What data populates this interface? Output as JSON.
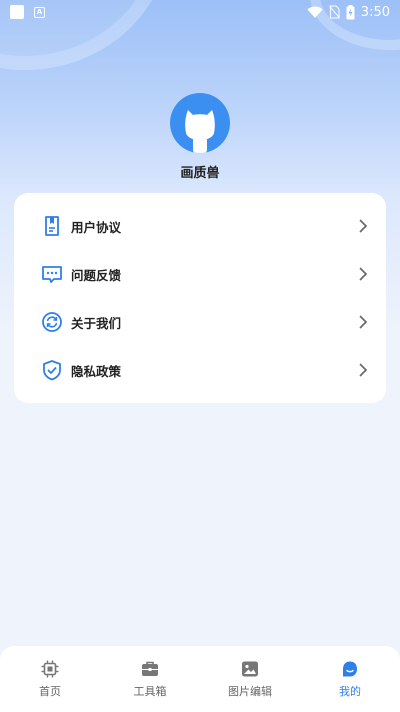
{
  "status_bar": {
    "time": "3:50",
    "icons": [
      "app-square-icon",
      "a-notification-icon",
      "wifi-icon",
      "no-sim-icon",
      "battery-charging-icon"
    ]
  },
  "profile": {
    "avatar_icon": "cat-avatar-icon",
    "name": "画质兽"
  },
  "menu": {
    "items": [
      {
        "label": "用户协议",
        "icon": "document-icon"
      },
      {
        "label": "问题反馈",
        "icon": "feedback-message-icon"
      },
      {
        "label": "关于我们",
        "icon": "refresh-circle-icon"
      },
      {
        "label": "隐私政策",
        "icon": "shield-check-icon"
      }
    ],
    "arrow_icon": "chevron-right-icon"
  },
  "tabbar": {
    "tabs": [
      {
        "label": "首页",
        "icon": "chip-icon",
        "active": false
      },
      {
        "label": "工具箱",
        "icon": "toolbox-icon",
        "active": false
      },
      {
        "label": "图片编辑",
        "icon": "image-icon",
        "active": false
      },
      {
        "label": "我的",
        "icon": "profile-blob-icon",
        "active": true
      }
    ]
  },
  "colors": {
    "accent": "#2f7fe8",
    "avatar_bg": "#3b8ff0",
    "tab_inactive": "#666666",
    "page_bg": "#eef3fc"
  }
}
